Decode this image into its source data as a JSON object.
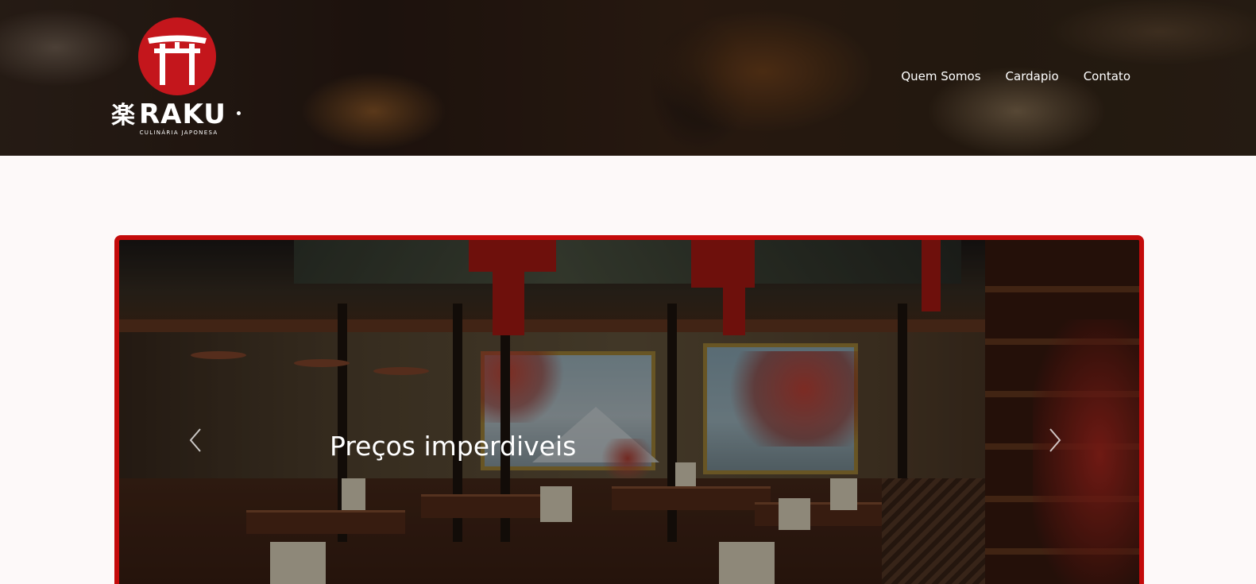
{
  "brand": {
    "kanji": "楽",
    "name": "RAKU",
    "tagline": "CULINÁRIA JAPONESA",
    "accent_color": "#c4161c",
    "logo_icon": "torii-gate-icon"
  },
  "nav": {
    "items": [
      {
        "label": "Quem Somos"
      },
      {
        "label": "Cardapio"
      },
      {
        "label": "Contato"
      }
    ]
  },
  "carousel": {
    "border_color": "#c40b0b",
    "caption": "Preços imperdiveis",
    "prev_icon": "chevron-left-icon",
    "next_icon": "chevron-right-icon"
  }
}
